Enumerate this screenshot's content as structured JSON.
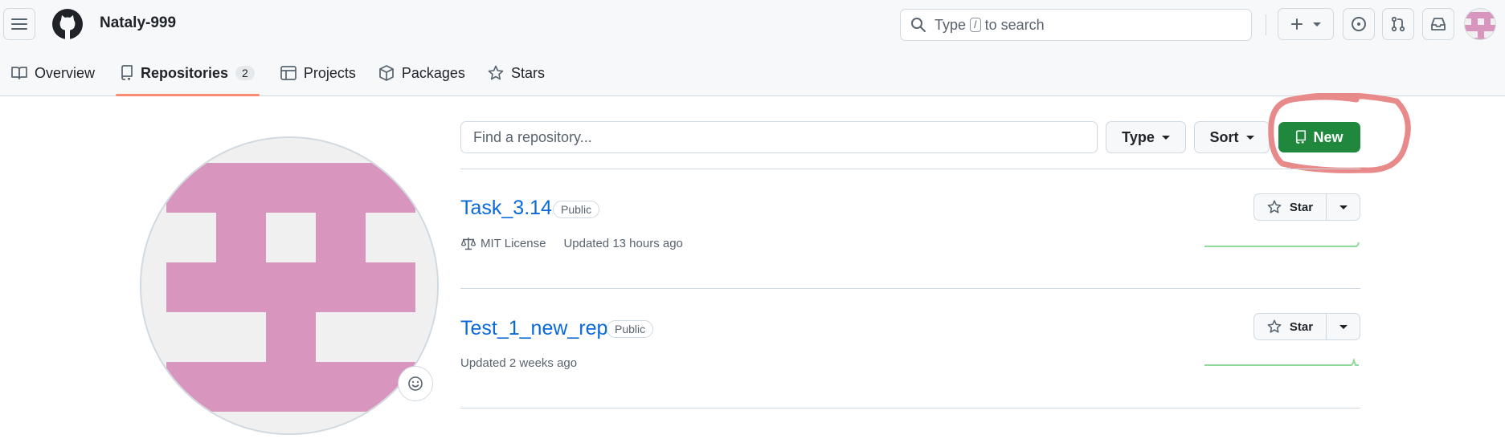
{
  "header": {
    "username": "Nataly-999",
    "search_text_before": "Type",
    "search_kbd": "/",
    "search_text_after": "to search",
    "icons": [
      "hamburger-icon",
      "github-logo-icon",
      "search-icon",
      "plus-icon",
      "issue-icon",
      "pull-request-icon",
      "inbox-icon"
    ]
  },
  "nav": {
    "tabs": [
      {
        "label": "Overview",
        "icon": "book-icon"
      },
      {
        "label": "Repositories",
        "icon": "repo-icon",
        "count": "2",
        "active": true
      },
      {
        "label": "Projects",
        "icon": "table-icon"
      },
      {
        "label": "Packages",
        "icon": "package-icon"
      },
      {
        "label": "Stars",
        "icon": "star-icon"
      }
    ]
  },
  "toolbar": {
    "find_placeholder": "Find a repository...",
    "type_label": "Type",
    "sort_label": "Sort",
    "new_label": "New"
  },
  "repos": [
    {
      "name": "Task_3.14",
      "visibility": "Public",
      "license": "MIT License",
      "updated": "Updated 13 hours ago",
      "star_label": "Star"
    },
    {
      "name": "Test_1_new_rep",
      "visibility": "Public",
      "updated": "Updated 2 weeks ago",
      "star_label": "Star"
    }
  ],
  "colors": {
    "accent_green": "#1f883d",
    "link_blue": "#0969da",
    "avatar_pink": "#d895bd",
    "annotation_red": "#e8898a",
    "tab_underline": "#fd8c73"
  }
}
